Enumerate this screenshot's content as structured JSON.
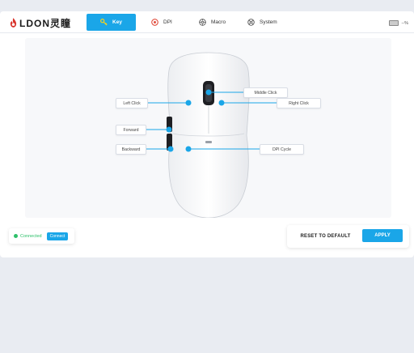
{
  "app": {
    "brand": "LDON灵瞳"
  },
  "tabs": [
    {
      "label": "Key",
      "icon": "key-icon",
      "active": true
    },
    {
      "label": "DPI",
      "icon": "dpi-icon",
      "active": false
    },
    {
      "label": "Macro",
      "icon": "macro-icon",
      "active": false
    },
    {
      "label": "System",
      "icon": "system-icon",
      "active": false
    }
  ],
  "battery": {
    "text": "--%"
  },
  "buttons": {
    "left_click": "Left Click",
    "middle_click": "Middle Click",
    "right_click": "Right Click",
    "forward": "Forward",
    "backward": "Backward",
    "dpi_cycle": "DPI Cycle"
  },
  "status": {
    "text": "Connected",
    "connect_label": "Connect"
  },
  "actions": {
    "reset_label": "RESET TO DEFAULT",
    "apply_label": "APPLY"
  },
  "colors": {
    "accent": "#1aa6e8",
    "connected": "#2ec06a",
    "background": "#e9ecf2"
  }
}
